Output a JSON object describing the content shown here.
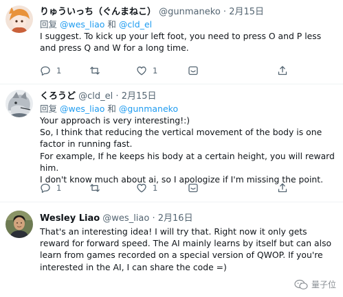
{
  "tweets": [
    {
      "name": "りゅういっち（ぐんまねこ）",
      "handle": "@gunmaneko",
      "dot": "·",
      "date": "2月15日",
      "reply_prefix": "回复",
      "reply_conj": "和",
      "reply_to": [
        "@wes_liao",
        "@cld_el"
      ],
      "text": [
        "I suggest. To kick up your left foot, you need to press O and P less and press Q and W for a long time."
      ],
      "counts": {
        "reply": "1",
        "retweet": "",
        "like": "1"
      }
    },
    {
      "name": "くろうど",
      "handle": "@cld_el",
      "dot": "·",
      "date": "2月15日",
      "reply_prefix": "回复",
      "reply_conj": "和",
      "reply_to": [
        "@wes_liao",
        "@gunmaneko"
      ],
      "text": [
        "Your approach is very interesting!:)",
        "So, I think that reducing the vertical movement of the body is one factor in running fast.",
        "For example, If he keeps his body at a certain height, you will reward him.",
        "I don't know much about ai, so I apologize if I'm missing the point."
      ],
      "counts": {
        "reply": "1",
        "retweet": "",
        "like": "1"
      }
    },
    {
      "name": "Wesley Liao",
      "handle": "@wes_liao",
      "dot": "·",
      "date": "2月16日",
      "text": [
        "That's an interesting idea! I will try that. Right now it only gets reward for forward speed. The AI mainly learns by itself but can also learn from games recorded on a special version of QWOP. If you're interested in the AI, I can share the code =)"
      ]
    }
  ],
  "watermark": {
    "text": "量子位",
    "icon": "wechat-icon"
  },
  "colors": {
    "mention": "#1d9bf0",
    "muted": "#536471",
    "text": "#0f1419",
    "divider": "#eff3f4"
  },
  "icons": [
    "reply-icon",
    "retweet-icon",
    "like-icon",
    "react-icon",
    "share-icon"
  ]
}
